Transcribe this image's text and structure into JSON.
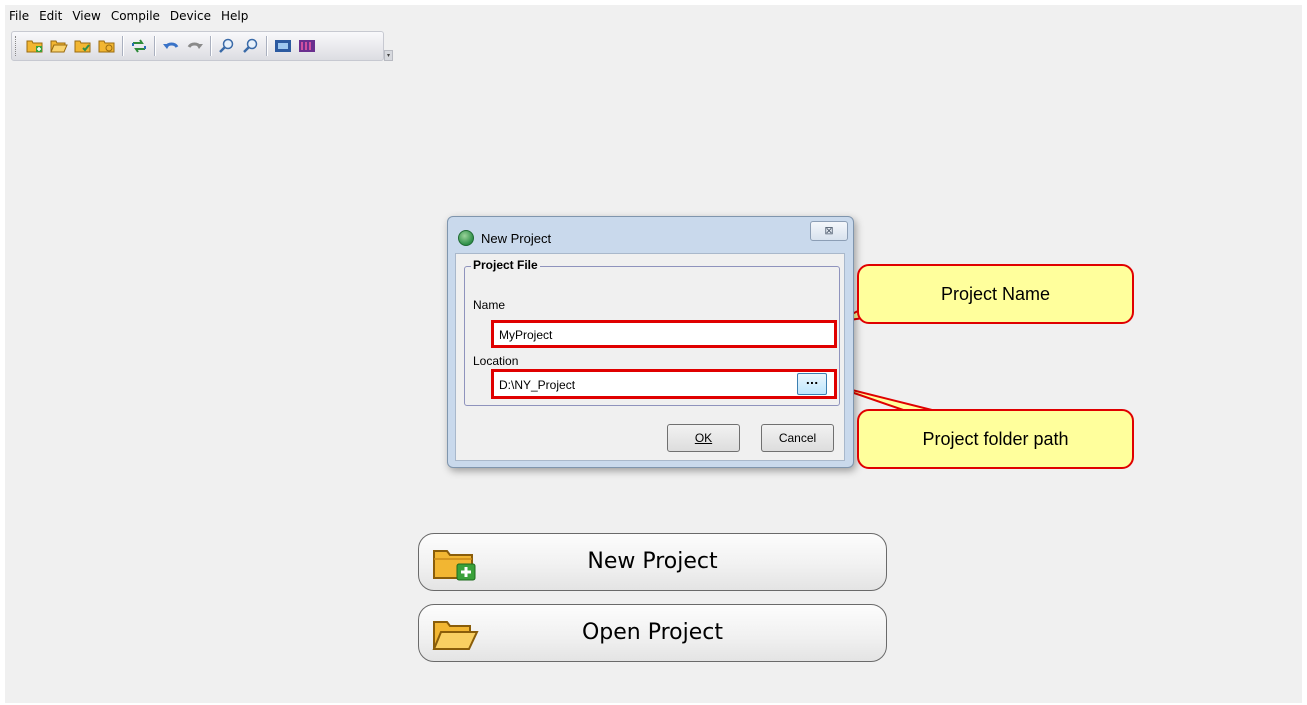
{
  "menu": [
    "File",
    "Edit",
    "View",
    "Compile",
    "Device",
    "Help"
  ],
  "toolbar": {
    "buttons": [
      "new-project-icon",
      "open-project-icon",
      "save-project-icon",
      "save-all-icon",
      "compile-icon",
      "undo-icon",
      "redo-icon",
      "zoom-in-icon",
      "zoom-out-icon",
      "device-icon",
      "spectrum-icon"
    ]
  },
  "dialog": {
    "title": "New Project",
    "close_glyph": "⊠",
    "group_title": "Project File",
    "name_label": "Name",
    "name_value": "MyProject",
    "location_label": "Location",
    "location_value": "D:\\NY_Project",
    "browse_label": "...",
    "ok_label": "OK",
    "cancel_label": "Cancel"
  },
  "callouts": {
    "project_name": "Project Name",
    "project_folder_path": "Project folder path"
  },
  "main": {
    "new_project_label": "New Project",
    "open_project_label": "Open Project"
  },
  "colors": {
    "highlight": "#e00000",
    "callout_fill": "#ffff9c",
    "folder": "#f2b632"
  }
}
